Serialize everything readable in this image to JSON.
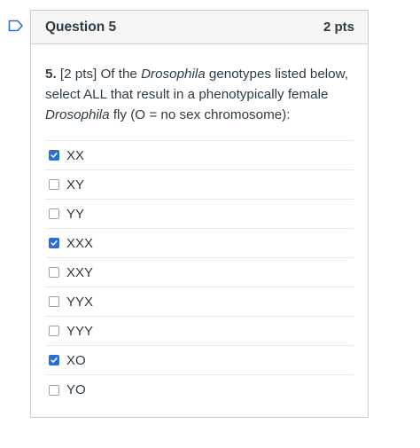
{
  "question": {
    "title": "Question 5",
    "points": "2 pts",
    "text": {
      "number": "5.",
      "part1": " [2 pts] Of the ",
      "italic1": "Drosophila",
      "part2": " genotypes listed below, select ALL that result in a phenotypically female ",
      "italic2": "Drosophila",
      "part3": " fly (O = no sex chromosome):"
    }
  },
  "answers": [
    {
      "label": "XX",
      "checked": true
    },
    {
      "label": "XY",
      "checked": false
    },
    {
      "label": "YY",
      "checked": false
    },
    {
      "label": "XXX",
      "checked": true
    },
    {
      "label": "XXY",
      "checked": false
    },
    {
      "label": "YYX",
      "checked": false
    },
    {
      "label": "YYY",
      "checked": false
    },
    {
      "label": "XO",
      "checked": true
    },
    {
      "label": "YO",
      "checked": false
    }
  ],
  "colors": {
    "accent": "#2b6fcf",
    "flag": "#2b6fcf",
    "header_bg": "#f5f5f5",
    "border": "#c7cdd1"
  },
  "icons": {
    "flag": "bookmark-flag-icon",
    "check": "checkmark-icon"
  }
}
